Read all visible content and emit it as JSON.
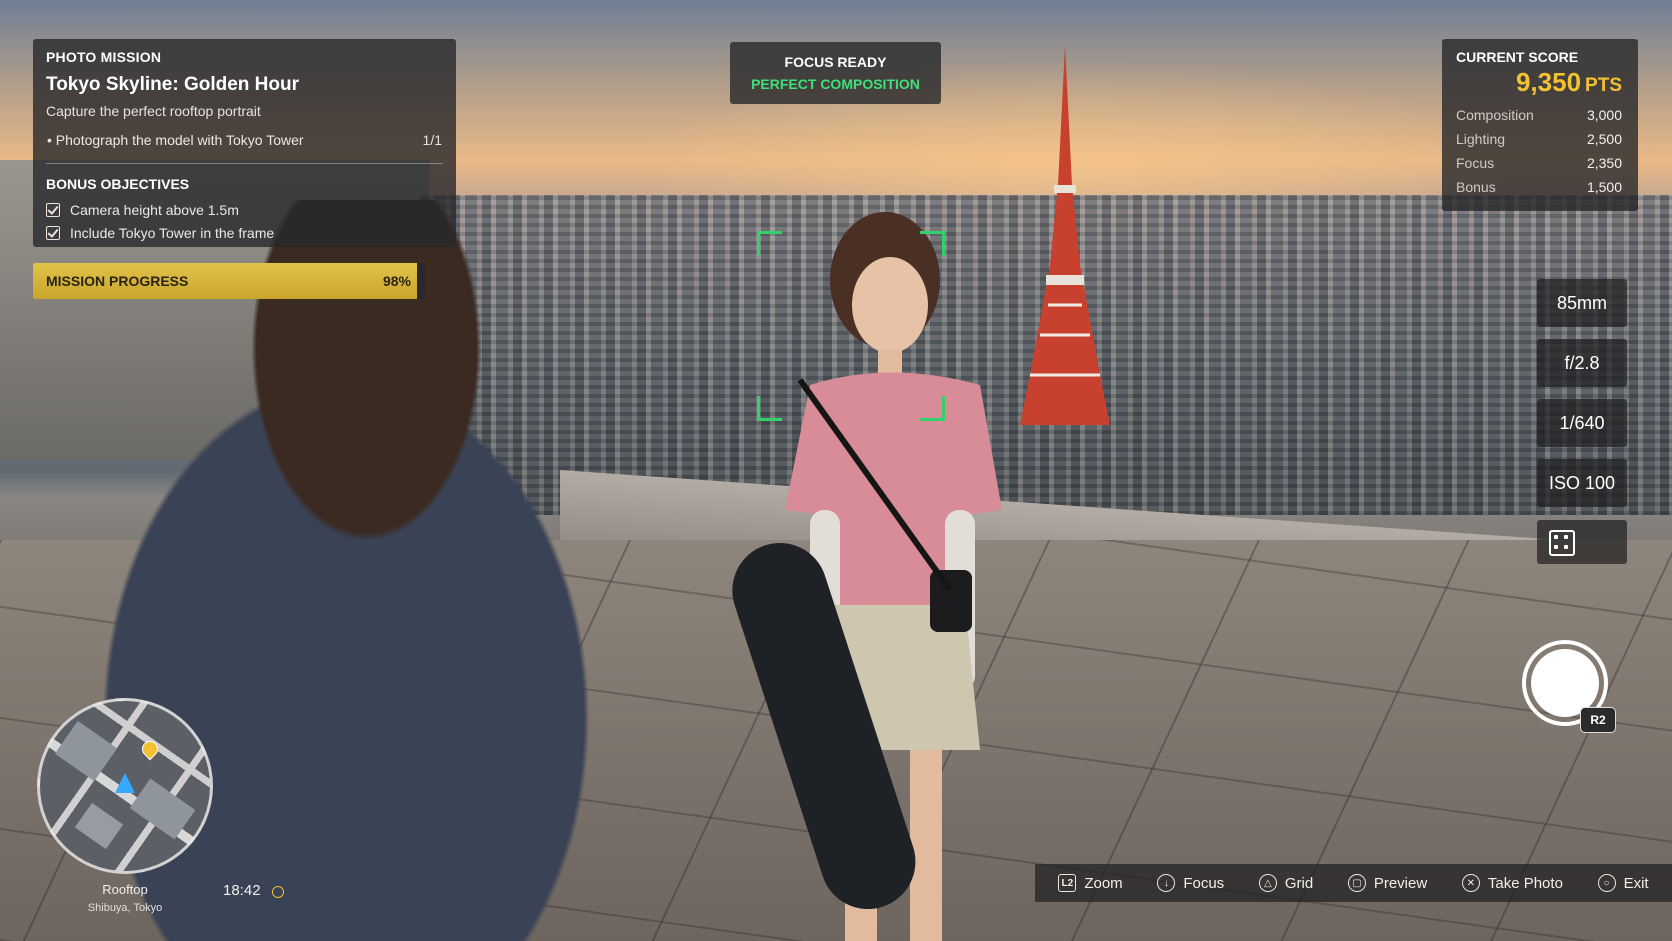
{
  "mission": {
    "header": "PHOTO MISSION",
    "title": "Tokyo Skyline: Golden Hour",
    "subtitle": "Capture the perfect rooftop portrait",
    "objective": "Photograph the model with Tokyo Tower",
    "objective_count": "1/1",
    "bonus_header": "BONUS OBJECTIVES",
    "bonus": [
      "Camera height above 1.5m",
      "Include Tokyo Tower in the frame"
    ]
  },
  "progress": {
    "label": "MISSION PROGRESS",
    "percent_text": "98%",
    "value": 0.98
  },
  "focus": {
    "status": "FOCUS READY",
    "composition": "PERFECT COMPOSITION",
    "composition_color": "#3ee07a"
  },
  "score": {
    "header": "CURRENT SCORE",
    "total": "9,350",
    "unit": "PTS",
    "accent": "#f2c233",
    "rows": [
      {
        "label": "Composition",
        "value": "3,000"
      },
      {
        "label": "Lighting",
        "value": "2,500"
      },
      {
        "label": "Focus",
        "value": "2,350"
      },
      {
        "label": "Bonus",
        "value": "1,500"
      }
    ]
  },
  "camera": {
    "focal_length": "85mm",
    "aperture": "f/2.8",
    "shutter_speed": "1/640",
    "iso": "ISO 100",
    "extra_icon": "frame-grid-icon"
  },
  "shutter": {
    "button_hint": "R2"
  },
  "map": {
    "location": "Rooftop",
    "area": "Shibuya, Tokyo",
    "time": "18:42",
    "weather_icon": "sun-icon"
  },
  "controls": [
    {
      "glyph": "L2",
      "label": "Zoom",
      "icon": "l2-button-icon"
    },
    {
      "glyph": "↓",
      "label": "Focus",
      "icon": "dpad-down-icon"
    },
    {
      "glyph": "△",
      "label": "Grid",
      "icon": "triangle-button-icon"
    },
    {
      "glyph": "▢",
      "label": "Preview",
      "icon": "square-button-icon"
    },
    {
      "glyph": "✕",
      "label": "Take Photo",
      "icon": "cross-button-icon"
    },
    {
      "glyph": "○",
      "label": "Exit",
      "icon": "circle-button-icon"
    }
  ]
}
